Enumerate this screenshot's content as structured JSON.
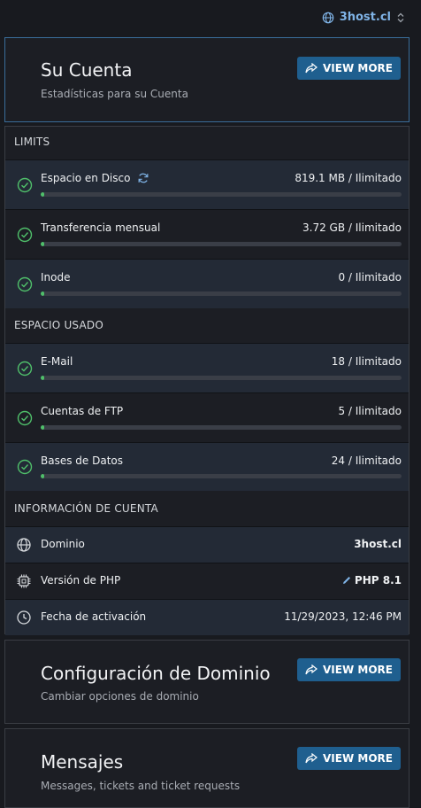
{
  "topbar": {
    "domain": "3host.cl"
  },
  "account_card": {
    "title": "Su Cuenta",
    "subtitle": "Estadísticas para su Cuenta",
    "button": "VIEW MORE"
  },
  "sections": {
    "limits": {
      "title": "LIMITS",
      "items": [
        {
          "label": "Espacio en Disco",
          "value": "819.1 MB / Ilimitado",
          "usage": 0.01
        },
        {
          "label": "Transferencia mensual",
          "value": "3.72 GB / Ilimitado",
          "usage": 0.01
        },
        {
          "label": "Inode",
          "value": "0 / Ilimitado",
          "usage": 0.01
        }
      ]
    },
    "used": {
      "title": "ESPACIO USADO",
      "items": [
        {
          "label": "E-Mail",
          "value": "18 / Ilimitado",
          "usage": 0.01
        },
        {
          "label": "Cuentas de FTP",
          "value": "5 / Ilimitado",
          "usage": 0.01
        },
        {
          "label": "Bases de Datos",
          "value": "24 / Ilimitado",
          "usage": 0.01
        }
      ]
    },
    "info": {
      "title": "INFORMACIÓN DE CUENTA",
      "items": [
        {
          "label": "Dominio",
          "value": "3host.cl"
        },
        {
          "label": "Versión de PHP",
          "value": "PHP 8.1"
        },
        {
          "label": "Fecha de activación",
          "value": "11/29/2023, 12:46 PM"
        }
      ]
    }
  },
  "domain_card": {
    "title": "Configuración de Dominio",
    "subtitle": "Cambiar opciones de dominio",
    "button": "VIEW MORE"
  },
  "messages_card": {
    "title": "Mensajes",
    "subtitle": "Messages, tickets and ticket requests",
    "button": "VIEW MORE"
  },
  "colors": {
    "accent": "#1f5f8f",
    "link": "#7fb3e6",
    "ok": "#4fbf6a"
  },
  "icons": {
    "check": "check-circle-icon",
    "refresh": "refresh-icon",
    "globe": "globe-icon",
    "chip": "chip-icon",
    "clock": "clock-icon",
    "share": "share-icon",
    "edit": "pencil-icon"
  }
}
